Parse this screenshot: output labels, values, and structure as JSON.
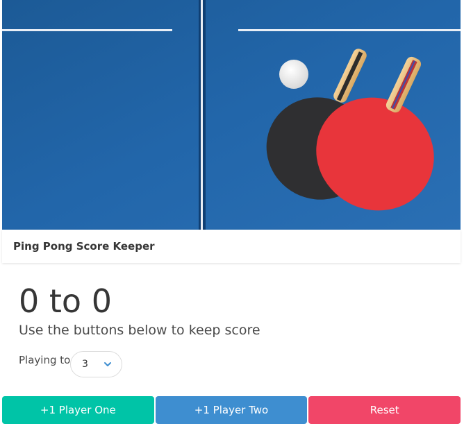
{
  "hero": {
    "image_description_icon": "ping-pong-table-image",
    "table_color": "#1f64a3",
    "paddle_red": "#e8353b",
    "paddle_black": "#3a3a3c"
  },
  "card": {
    "title": "Ping Pong Score Keeper"
  },
  "scoreboard": {
    "score_text": "0 to 0",
    "instructions": "Use the buttons below to keep score",
    "playing_to_label": "Playing to",
    "playing_to_value": "3"
  },
  "buttons": {
    "player_one": "+1 Player One",
    "player_two": "+1 Player Two",
    "reset": "Reset"
  },
  "colors": {
    "player_one": "#00c4a7",
    "player_two": "#3e8ed0",
    "reset": "#f14668"
  }
}
